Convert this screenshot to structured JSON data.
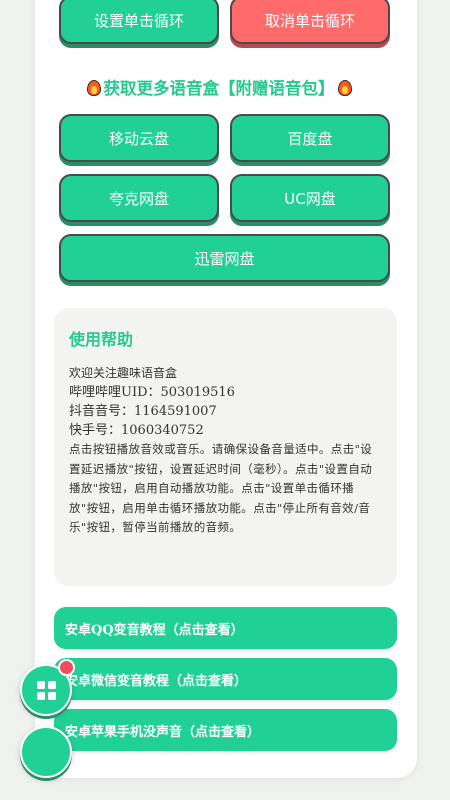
{
  "loop_buttons": {
    "set_label": "设置单击循环",
    "cancel_label": "取消单击循环"
  },
  "more_boxes": {
    "title": "获取更多语音盒【附赠语音包】",
    "disks": [
      "移动云盘",
      "百度盘",
      "夸克网盘",
      "UC网盘",
      "迅雷网盘"
    ]
  },
  "help": {
    "title": "使用帮助",
    "lines": [
      "欢迎关注趣味语音盒",
      "哔哩哔哩UID：503019516",
      "抖音音号：1164591007",
      "快手号：1060340752"
    ],
    "paragraph": "点击按钮播放音效或音乐。请确保设备音量适中。点击\"设置延迟播放\"按钮，设置延迟时间（毫秒）。点击\"设置自动播放\"按钮，启用自动播放功能。点击\"设置单击循环播放\"按钮，启用单击循环播放功能。点击\"停止所有音效/音乐\"按钮，暂停当前播放的音频。"
  },
  "tutorials": [
    "安卓QQ变音教程（点击查看）",
    "安卓微信变音教程（点击查看）",
    "安卓苹果手机没声音（点击查看）"
  ],
  "icons": {
    "menu_fab": "grid-icon",
    "notification": "badge-dot",
    "second_fab": "circle-button",
    "title_decoration": "fire-icon"
  },
  "colors": {
    "accent": "#20d095",
    "danger": "#ff6b6b",
    "badge": "#ee4e5e"
  }
}
